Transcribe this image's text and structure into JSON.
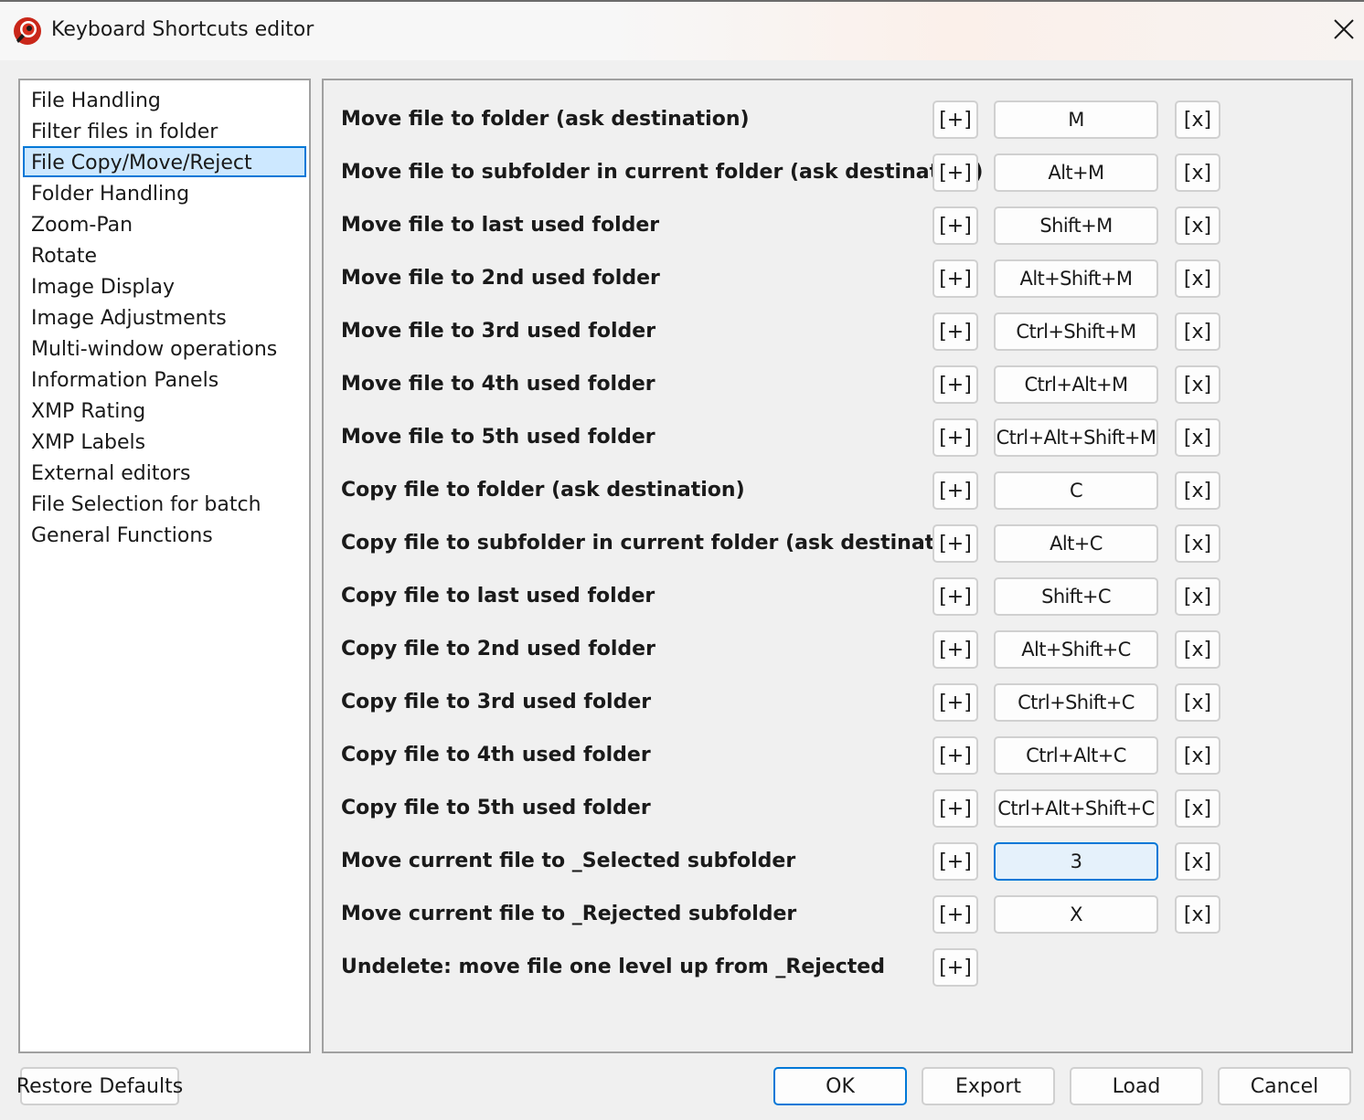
{
  "window": {
    "title": "Keyboard Shortcuts editor",
    "app_icon": "app-logo-icon",
    "close_icon": "close-icon"
  },
  "sidebar": {
    "selected_index": 2,
    "items": [
      {
        "label": "File Handling"
      },
      {
        "label": "Filter files in folder"
      },
      {
        "label": "File Copy/Move/Reject"
      },
      {
        "label": "Folder Handling"
      },
      {
        "label": "Zoom-Pan"
      },
      {
        "label": "Rotate"
      },
      {
        "label": "Image Display"
      },
      {
        "label": "Image Adjustments"
      },
      {
        "label": "Multi-window operations"
      },
      {
        "label": "Information Panels"
      },
      {
        "label": "XMP Rating"
      },
      {
        "label": "XMP Labels"
      },
      {
        "label": "External editors"
      },
      {
        "label": "File Selection for batch"
      },
      {
        "label": "General Functions"
      }
    ]
  },
  "shortcuts": {
    "add_label": "[+]",
    "remove_label": "[x]",
    "rows": [
      {
        "action": "Move file to folder (ask destination)",
        "key": "M"
      },
      {
        "action": "Move file to subfolder in current folder (ask destination)",
        "key": "Alt+M"
      },
      {
        "action": "Move file to last used folder",
        "key": "Shift+M"
      },
      {
        "action": "Move file to 2nd used folder",
        "key": "Alt+Shift+M"
      },
      {
        "action": "Move file to 3rd used folder",
        "key": "Ctrl+Shift+M"
      },
      {
        "action": "Move file to 4th used folder",
        "key": "Ctrl+Alt+M"
      },
      {
        "action": "Move file to 5th used folder",
        "key": "Ctrl+Alt+Shift+M"
      },
      {
        "action": "Copy file to folder (ask destination)",
        "key": "C"
      },
      {
        "action": "Copy file to subfolder in current folder (ask destination)",
        "key": "Alt+C"
      },
      {
        "action": "Copy file to last used folder",
        "key": "Shift+C"
      },
      {
        "action": "Copy file to 2nd used folder",
        "key": "Alt+Shift+C"
      },
      {
        "action": "Copy file to 3rd used folder",
        "key": "Ctrl+Shift+C"
      },
      {
        "action": "Copy file to 4th used folder",
        "key": "Ctrl+Alt+C"
      },
      {
        "action": "Copy file to 5th used folder",
        "key": "Ctrl+Alt+Shift+C"
      },
      {
        "action": "Move current file to _Selected subfolder",
        "key": "3",
        "active": true
      },
      {
        "action": "Move current file to _Rejected subfolder",
        "key": "X"
      },
      {
        "action": "Undelete: move file one level up from _Rejected",
        "key": null
      }
    ]
  },
  "footer": {
    "restore_defaults": "Restore Defaults",
    "ok": "OK",
    "export": "Export",
    "load": "Load",
    "cancel": "Cancel"
  },
  "colors": {
    "accent": "#0078d7",
    "selection_bg": "#cde8ff",
    "active_field_bg": "#e5f1fb",
    "window_bg": "#f0f0f0",
    "logo_red": "#d7301f"
  }
}
